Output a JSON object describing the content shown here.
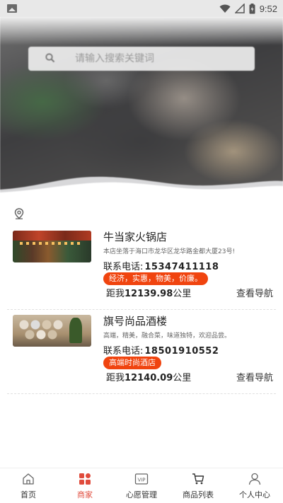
{
  "status_bar": {
    "time": "9:52",
    "icons": [
      "image-icon",
      "wifi-icon",
      "signal-icon",
      "battery-icon"
    ]
  },
  "search": {
    "placeholder": "请输入搜索关键词",
    "icon": "search-icon"
  },
  "location": {
    "icon": "location-pin-icon"
  },
  "shops": [
    {
      "name": "牛当家火锅店",
      "description": "本店坐落于海口市龙华区龙华路金都大厦23号!",
      "phone_label": "联系电话:",
      "phone": "15347411118",
      "tag": "经济，实惠，物美，价廉。",
      "distance_prefix": "距我",
      "distance": "12139.98",
      "distance_unit": "公里",
      "nav_label": "查看导航"
    },
    {
      "name": "旗号尚品酒楼",
      "description": "高端，精美，融合菜，味道独特，欢迎品尝。",
      "phone_label": "联系电话:",
      "phone": "18501910552",
      "tag": "高端时尚酒店",
      "distance_prefix": "距我",
      "distance": "12140.09",
      "distance_unit": "公里",
      "nav_label": "查看导航"
    }
  ],
  "tabbar": {
    "active_color": "#e04b3c",
    "tag_color": "#f0440f",
    "tabs": [
      {
        "label": "首页",
        "icon": "home-icon",
        "active": false
      },
      {
        "label": "商家",
        "icon": "shop-grid-icon",
        "active": true
      },
      {
        "label": "心愿管理",
        "icon": "vip-card-icon",
        "active": false
      },
      {
        "label": "商品列表",
        "icon": "cart-icon",
        "active": false
      },
      {
        "label": "个人中心",
        "icon": "user-icon",
        "active": false
      }
    ]
  }
}
